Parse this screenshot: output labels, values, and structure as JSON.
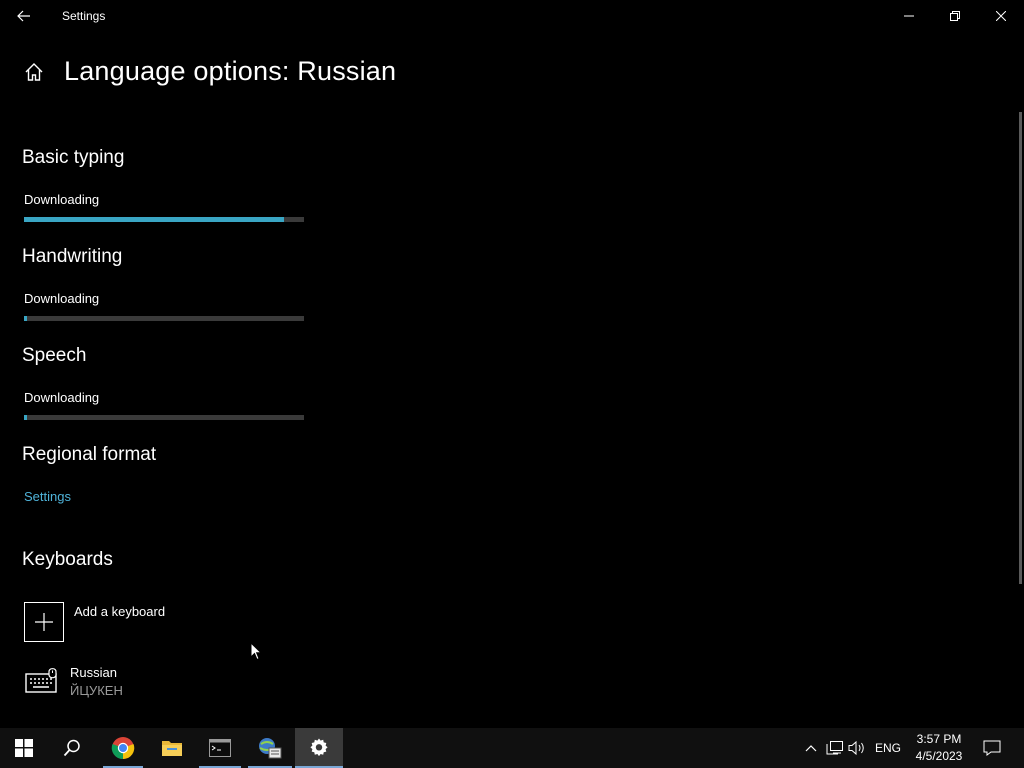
{
  "window": {
    "title": "Settings"
  },
  "page": {
    "title": "Language options: Russian"
  },
  "sections": {
    "basic_typing": {
      "heading": "Basic typing",
      "status": "Downloading",
      "progress": 0.93
    },
    "handwriting": {
      "heading": "Handwriting",
      "status": "Downloading",
      "progress": 0.01
    },
    "speech": {
      "heading": "Speech",
      "status": "Downloading",
      "progress": 0.01
    },
    "regional_format": {
      "heading": "Regional format",
      "link": "Settings"
    },
    "keyboards": {
      "heading": "Keyboards",
      "add_label": "Add a keyboard",
      "items": [
        {
          "name": "Russian",
          "layout": "ЙЦУКЕН"
        }
      ]
    }
  },
  "colors": {
    "accent": "#3aa6c4",
    "link": "#4fb3d9",
    "background": "#000000",
    "taskbar": "#101010"
  },
  "taskbar": {
    "apps": [
      {
        "name": "start-icon"
      },
      {
        "name": "search-icon"
      },
      {
        "name": "chrome-icon"
      },
      {
        "name": "file-explorer-icon"
      },
      {
        "name": "terminal-icon"
      },
      {
        "name": "network-app-icon"
      },
      {
        "name": "settings-gear-icon"
      }
    ],
    "tray": {
      "language": "ENG",
      "time": "3:57 PM",
      "date": "4/5/2023"
    }
  }
}
